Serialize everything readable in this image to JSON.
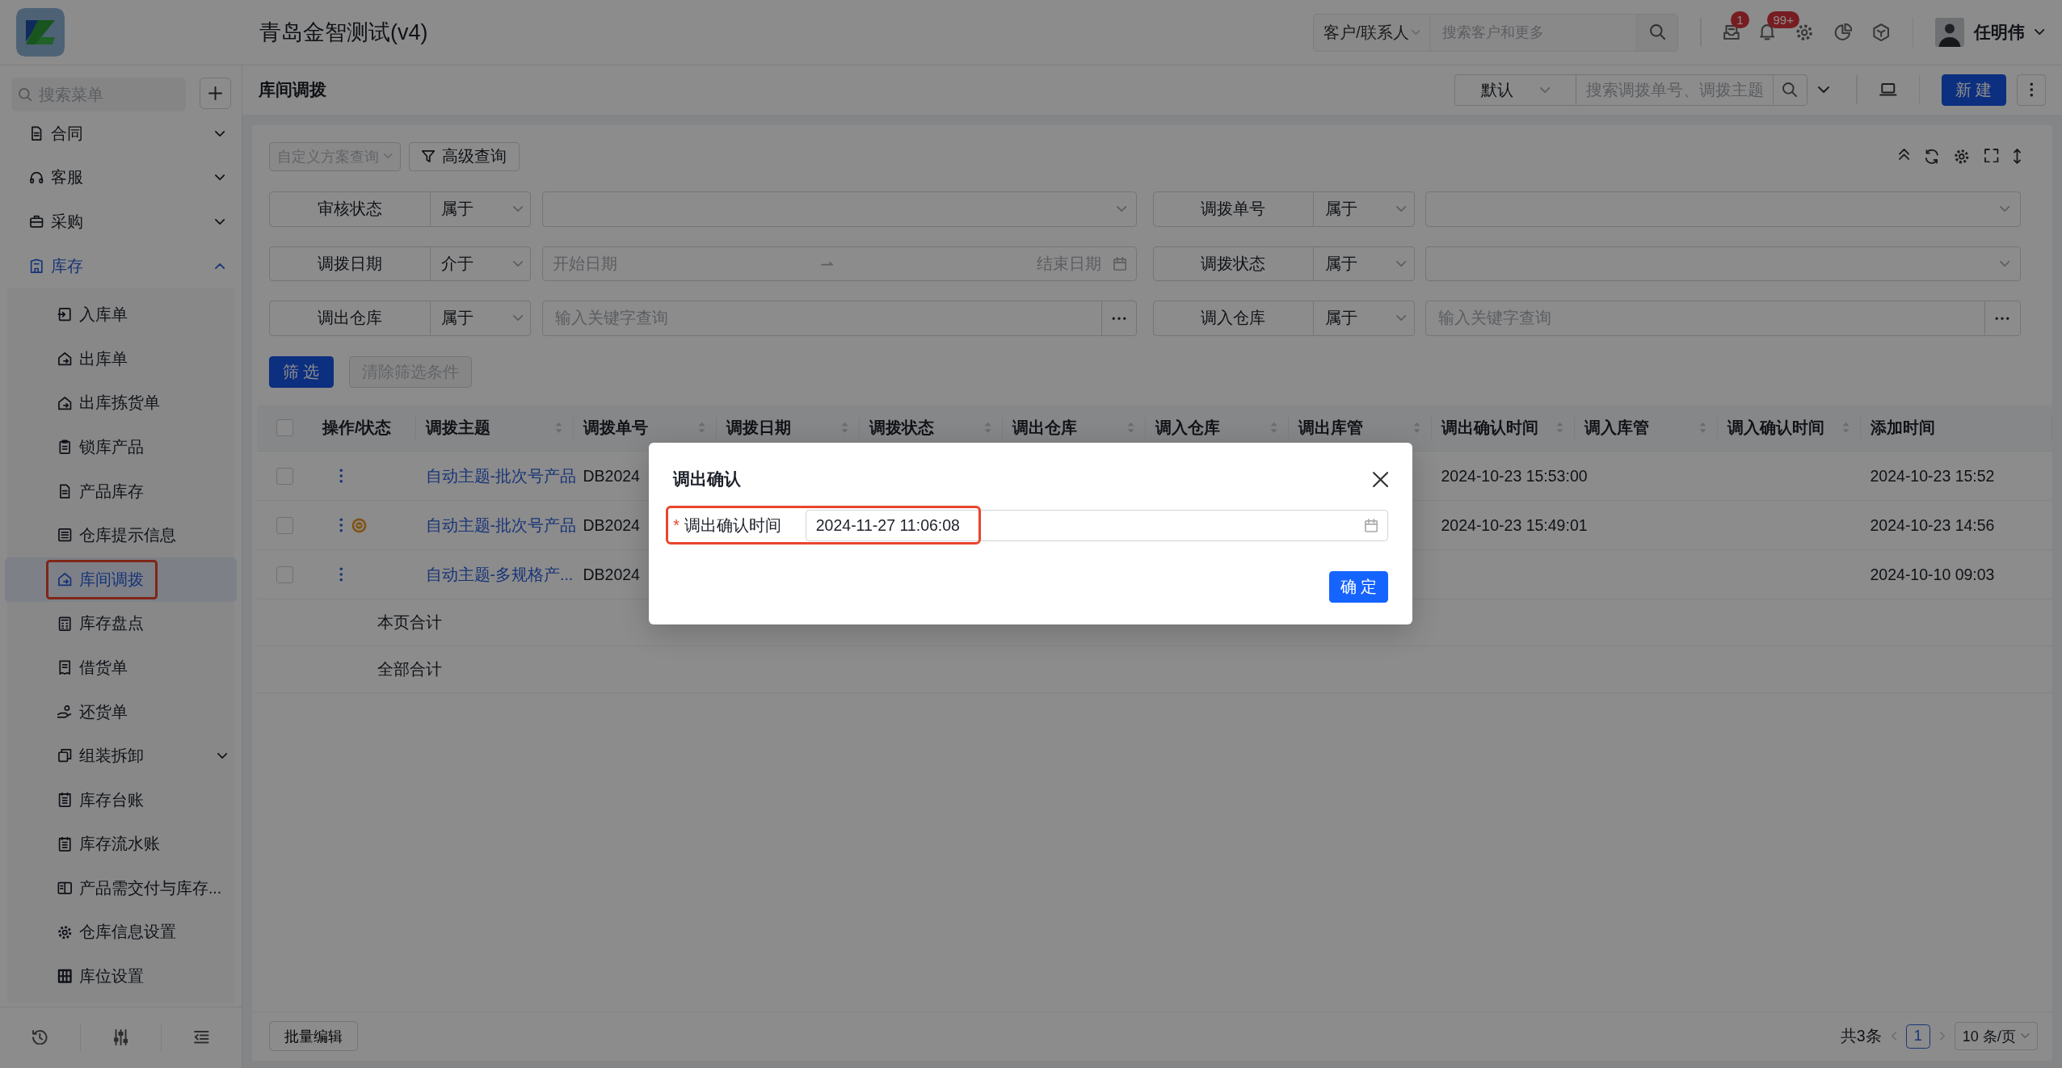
{
  "app": {
    "title": "青岛金智测试(v4)"
  },
  "header": {
    "search_scope": "客户/联系人",
    "search_placeholder": "搜索客户和更多",
    "notifications": [
      {
        "badge": "1"
      },
      {
        "badge": "99+"
      }
    ],
    "user": {
      "name": "任明伟"
    }
  },
  "sidebar": {
    "search_placeholder": "搜索菜单",
    "items": [
      {
        "label": "合同",
        "expanded": false
      },
      {
        "label": "客服",
        "expanded": false
      },
      {
        "label": "采购",
        "expanded": false
      },
      {
        "label": "库存",
        "expanded": true,
        "children": [
          {
            "label": "入库单",
            "selected": false,
            "highlighted": false
          },
          {
            "label": "出库单",
            "selected": false,
            "highlighted": false
          },
          {
            "label": "出库拣货单",
            "selected": false,
            "highlighted": false
          },
          {
            "label": "锁库产品",
            "selected": false,
            "highlighted": false
          },
          {
            "label": "产品库存",
            "selected": false,
            "highlighted": false
          },
          {
            "label": "仓库提示信息",
            "selected": false,
            "highlighted": false
          },
          {
            "label": "库间调拨",
            "selected": true,
            "highlighted": true
          },
          {
            "label": "库存盘点",
            "selected": false,
            "highlighted": false
          },
          {
            "label": "借货单",
            "selected": false,
            "highlighted": false
          },
          {
            "label": "还货单",
            "selected": false,
            "highlighted": false
          },
          {
            "label": "组装拆卸",
            "selected": false,
            "highlighted": false,
            "expanded": false
          },
          {
            "label": "库存台账",
            "selected": false,
            "highlighted": false
          },
          {
            "label": "库存流水账",
            "selected": false,
            "highlighted": false
          },
          {
            "label": "产品需交付与库存...",
            "selected": false,
            "highlighted": false
          },
          {
            "label": "仓库信息设置",
            "selected": false,
            "highlighted": false
          },
          {
            "label": "库位设置",
            "selected": false,
            "highlighted": false
          }
        ]
      }
    ]
  },
  "page": {
    "title": "库间调拨",
    "view": "默认",
    "search_placeholder": "搜索调拨单号、调拨主题",
    "new_button": "新 建"
  },
  "filters": {
    "scheme": {
      "label": "自定义方案查询",
      "disabled": true
    },
    "advanced": "高级查询",
    "conditions": [
      {
        "field": "审核状态",
        "operator": "属于",
        "kind": "select"
      },
      {
        "field": "调拨单号",
        "operator": "属于",
        "kind": "select"
      },
      {
        "field": "调拨日期",
        "operator": "介于",
        "kind": "daterange",
        "start_placeholder": "开始日期",
        "end_placeholder": "结束日期"
      },
      {
        "field": "调拨状态",
        "operator": "属于",
        "kind": "select"
      },
      {
        "field": "调出仓库",
        "operator": "属于",
        "kind": "keyword",
        "placeholder": "输入关键字查询"
      },
      {
        "field": "调入仓库",
        "operator": "属于",
        "kind": "keyword",
        "placeholder": "输入关键字查询"
      }
    ],
    "apply": "筛 选",
    "clear": {
      "label": "清除筛选条件",
      "disabled": true
    }
  },
  "table": {
    "all_checked": false,
    "columns": [
      {
        "label": "操作/状态",
        "sortable": false
      },
      {
        "label": "调拨主题",
        "sortable": true
      },
      {
        "label": "调拨单号",
        "sortable": true
      },
      {
        "label": "调拨日期",
        "sortable": true
      },
      {
        "label": "调拨状态",
        "sortable": true
      },
      {
        "label": "调出仓库",
        "sortable": true
      },
      {
        "label": "调入仓库",
        "sortable": true
      },
      {
        "label": "调出库管",
        "sortable": true
      },
      {
        "label": "调出确认时间",
        "sortable": true
      },
      {
        "label": "调入库管",
        "sortable": true
      },
      {
        "label": "调入确认时间",
        "sortable": true
      },
      {
        "label": "添加时间",
        "sortable": false
      }
    ],
    "rows": [
      {
        "checked": false,
        "marked": false,
        "subject": "自动主题-批次号产品",
        "number": "DB2024",
        "out_confirm_time": "2024-10-23 15:53:00",
        "added_time": "2024-10-23 15:52"
      },
      {
        "checked": false,
        "marked": true,
        "subject": "自动主题-批次号产品",
        "number": "DB2024",
        "out_confirm_time": "2024-10-23 15:49:01",
        "added_time": "2024-10-23 14:56"
      },
      {
        "checked": false,
        "marked": false,
        "subject": "自动主题-多规格产...",
        "number": "DB2024",
        "added_time": "2024-10-10 09:03"
      }
    ],
    "summary_rows": [
      "本页合计",
      "全部合计"
    ]
  },
  "footer": {
    "batch_edit": "批量编辑",
    "total": "共3条",
    "pages": [
      {
        "label": "1",
        "selected": true
      }
    ],
    "page_size": "10 条/页"
  },
  "dialog": {
    "title": "调出确认",
    "field": {
      "required_mark": "*",
      "label": "调出确认时间",
      "value": "2024-11-27 11:06:08",
      "highlighted": true
    },
    "confirm": "确 定"
  }
}
